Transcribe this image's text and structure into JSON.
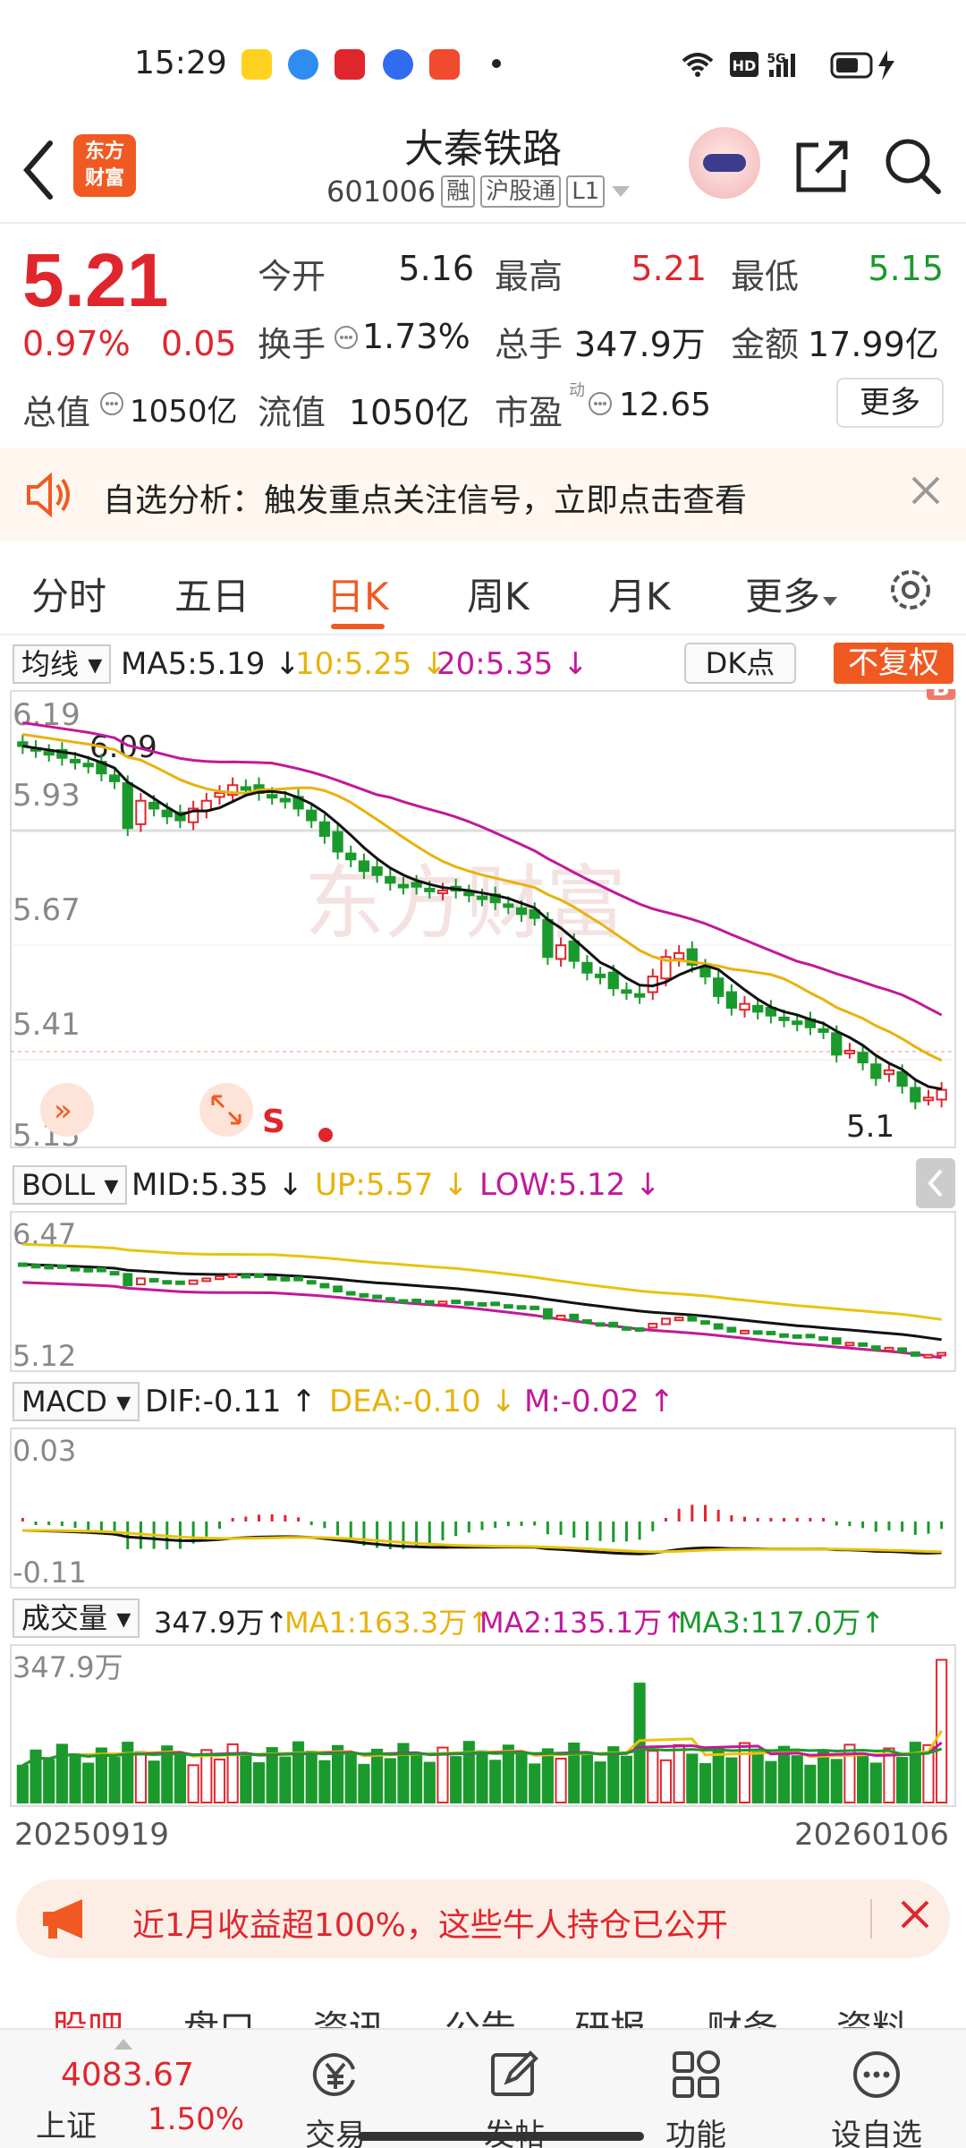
{
  "status_bar": {
    "time": "15:29",
    "hd": "HD",
    "net": "5G"
  },
  "header": {
    "brand": [
      "东方",
      "财富"
    ],
    "stock_name": "大秦铁路",
    "stock_code": "601006",
    "tag_rong": "融",
    "tag_hgt": "沪股通",
    "tag_level": "L1"
  },
  "quote": {
    "price": "5.21",
    "pct": "0.97%",
    "chg": "0.05",
    "open_label": "今开",
    "open": "5.16",
    "high_label": "最高",
    "high": "5.21",
    "low_label": "最低",
    "low": "5.15",
    "turnover_label": "换手",
    "turnover": "1.73%",
    "volume_label": "总手",
    "volume": "347.9万",
    "amount_label": "金额",
    "amount": "17.99亿",
    "total_value_label": "总值",
    "total_value": "1050亿",
    "float_value_label": "流值",
    "float_value": "1050亿",
    "pe_label": "市盈",
    "pe_sup": "动",
    "pe": "12.65",
    "more": "更多"
  },
  "notice": {
    "text": "自选分析：触发重点关注信号，立即点击查看"
  },
  "tabs": [
    "分时",
    "五日",
    "日K",
    "周K",
    "月K",
    "更多"
  ],
  "indicators": {
    "ma_sel": "均线",
    "ma5": "MA5:5.19",
    "ma10": "10:5.25",
    "ma20": "20:5.35",
    "dk": "DK点",
    "nofq": "不复权",
    "boll_sel": "BOLL",
    "mid": "MID:5.35",
    "up": "UP:5.57",
    "lowb": "LOW:5.12",
    "macd_sel": "MACD",
    "dif": "DIF:-0.11",
    "dea": "DEA:-0.10",
    "m": "M:-0.02",
    "vol_sel": "成交量",
    "vol": "347.9万",
    "vma1": "MA1:163.3万",
    "vma2": "MA2:135.1万",
    "vma3": "MA3:117.0万"
  },
  "chart_data": {
    "type": "candlestick",
    "ylim": [
      5.15,
      6.19
    ],
    "y_ticks": [
      "6.19",
      "5.93",
      "5.67",
      "5.41",
      "5.15"
    ],
    "annotations": {
      "high": "6.09",
      "low": "5.1",
      "sell": "S"
    },
    "boll_ticks": [
      "6.47",
      "5.12"
    ],
    "macd_ticks": [
      "0.03",
      "-0.11"
    ],
    "vol_tick": "347.9万",
    "x_start": "20250919",
    "x_end": "20260106",
    "closes": [
      6.09,
      6.08,
      6.07,
      6.06,
      6.05,
      6.04,
      6.02,
      6.0,
      5.88,
      5.95,
      5.93,
      5.91,
      5.9,
      5.93,
      5.95,
      5.97,
      5.99,
      5.98,
      5.97,
      5.96,
      5.95,
      5.93,
      5.9,
      5.86,
      5.82,
      5.8,
      5.77,
      5.76,
      5.74,
      5.73,
      5.73,
      5.72,
      5.72,
      5.72,
      5.71,
      5.7,
      5.69,
      5.68,
      5.66,
      5.65,
      5.55,
      5.58,
      5.54,
      5.51,
      5.5,
      5.47,
      5.46,
      5.45,
      5.5,
      5.55,
      5.56,
      5.53,
      5.5,
      5.45,
      5.42,
      5.43,
      5.41,
      5.4,
      5.39,
      5.38,
      5.37,
      5.36,
      5.3,
      5.31,
      5.28,
      5.24,
      5.26,
      5.22,
      5.18,
      5.19,
      5.21
    ]
  },
  "promo": {
    "text": "近1月收益超100%，这些牛人持仓已公开"
  },
  "subtabs": [
    "股吧",
    "盘口",
    "资讯",
    "公告",
    "研报",
    "财务",
    "资料"
  ],
  "bottom": {
    "index_val": "4083.67",
    "index_name": "上证",
    "index_pct": "1.50%",
    "nav": [
      "交易",
      "发帖",
      "功能",
      "设自选"
    ]
  }
}
